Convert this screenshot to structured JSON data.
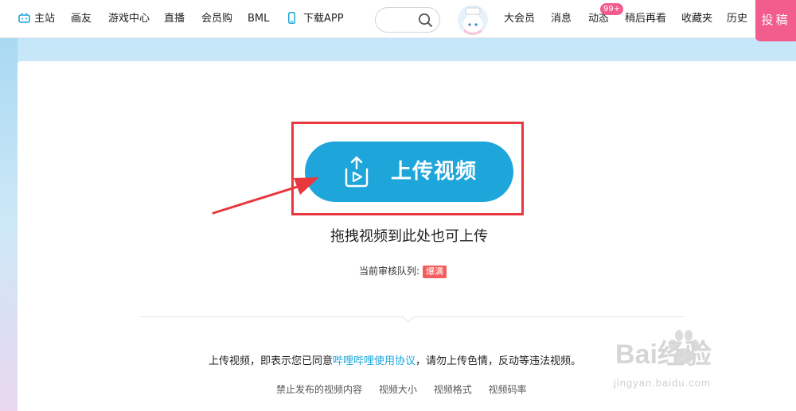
{
  "nav": {
    "items": [
      "主站",
      "画友",
      "游戏中心",
      "直播",
      "会员购",
      "BML",
      "下载APP"
    ],
    "right_items": [
      "大会员",
      "消息",
      "动态",
      "稍后再看",
      "收藏夹",
      "历史"
    ],
    "dynamic_badge": "99+",
    "upload_label": "投稿"
  },
  "upload": {
    "button_label": "上传视频",
    "drag_hint": "拖拽视频到此处也可上传",
    "queue_label": "当前审核队列:",
    "queue_status": "爆满"
  },
  "agreement": {
    "prefix": "上传视频，即表示您已同意",
    "link": "哔哩哔哩使用协议",
    "suffix": "，请勿上传色情，反动等违法视频。"
  },
  "rules": [
    "禁止发布的视频内容",
    "视频大小",
    "视频格式",
    "视频码率"
  ],
  "watermark": {
    "text": "Bai经验",
    "url": "jingyan.baidu.com"
  },
  "colors": {
    "brand_blue": "#1ea6db",
    "brand_pink": "#f25d8e",
    "highlight_red": "#e8383d"
  }
}
